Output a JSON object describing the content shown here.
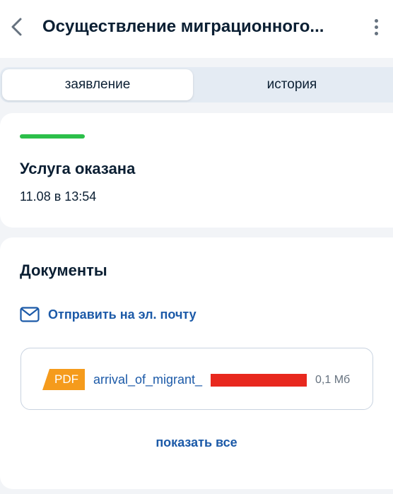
{
  "header": {
    "title": "Осуществление миграционного..."
  },
  "tabs": [
    {
      "label": "заявление",
      "active": true
    },
    {
      "label": "история",
      "active": false
    }
  ],
  "status": {
    "title": "Услуга оказана",
    "date": "11.08 в 13:54",
    "bar_color": "#2cbf4a"
  },
  "documents": {
    "title": "Документы",
    "email_link": "Отправить на эл. почту",
    "file": {
      "type": "PDF",
      "name": "arrival_of_migrant_",
      "size": "0,1 Мб"
    },
    "show_all": "показать все"
  },
  "colors": {
    "link": "#1c5aa8",
    "pdf_badge": "#f59b1c",
    "redaction": "#e8281e"
  },
  "icons": {
    "back": "chevron-left-icon",
    "more": "more-vertical-icon",
    "email": "envelope-icon",
    "file": "pdf-icon"
  }
}
